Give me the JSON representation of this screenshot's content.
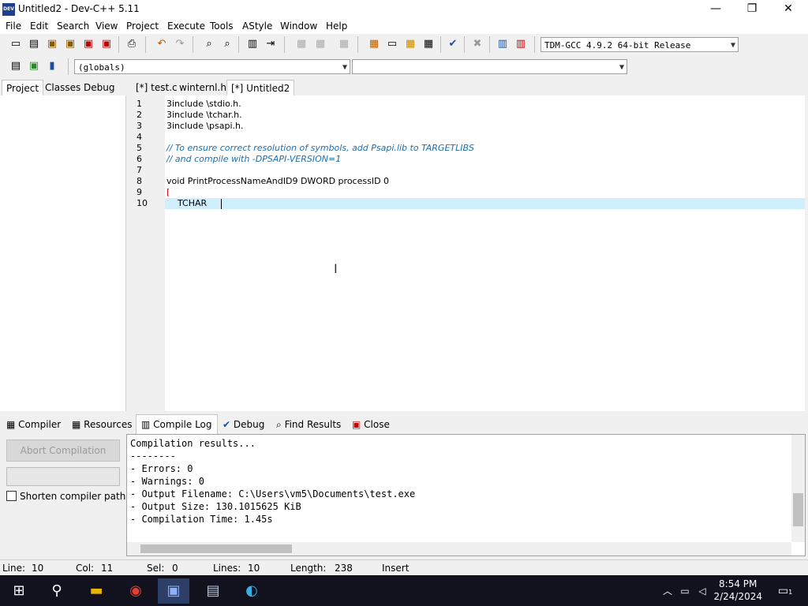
{
  "window": {
    "title": "Untitled2 - Dev-C++ 5.11",
    "app_icon_text": "DEV",
    "minimize": "—",
    "restore": "❐",
    "close": "✕"
  },
  "menu": [
    "File",
    "Edit",
    "Search",
    "View",
    "Project",
    "Execute",
    "Tools",
    "AStyle",
    "Window",
    "Help"
  ],
  "toolbar": {
    "compiler_select": "TDM-GCC 4.9.2 64-bit Release",
    "scope_select": "(globals)",
    "function_select": ""
  },
  "left_tabs": [
    "Project",
    "Classes",
    "Debug"
  ],
  "editor_tabs": [
    "[*] test.c",
    "winternl.h",
    "[*] Untitled2"
  ],
  "editor": {
    "lines": [
      {
        "n": "1",
        "text": "3include \\stdio.h."
      },
      {
        "n": "2",
        "text": "3include \\tchar.h."
      },
      {
        "n": "3",
        "text": "3include \\psapi.h."
      },
      {
        "n": "4",
        "text": ""
      },
      {
        "n": "5",
        "text": "// To ensure correct resolution of symbols, add Psapi.lib to TARGETLIBS"
      },
      {
        "n": "6",
        "text": "// and compile with -DPSAPI-VERSION=1"
      },
      {
        "n": "7",
        "text": ""
      },
      {
        "n": "8",
        "text": "void PrintProcessNameAndID9 DWORD processID 0"
      },
      {
        "n": "9",
        "text": "["
      },
      {
        "n": "10",
        "text": "    TCHAR "
      }
    ]
  },
  "bottom_tabs": [
    "Compiler",
    "Resources",
    "Compile Log",
    "Debug",
    "Find Results",
    "Close"
  ],
  "compile": {
    "abort_label": "Abort Compilation",
    "shorten_label": "Shorten compiler paths",
    "log": [
      "Compilation results...",
      "--------",
      "- Errors: 0",
      "- Warnings: 0",
      "- Output Filename: C:\\Users\\vm5\\Documents\\test.exe",
      "- Output Size: 130.1015625 KiB",
      "- Compilation Time: 1.45s"
    ]
  },
  "status": {
    "line": "Line:",
    "line_val": "10",
    "col": "Col:",
    "col_val": "11",
    "sel": "Sel:",
    "sel_val": "0",
    "lines": "Lines:",
    "lines_val": "10",
    "length": "Length:",
    "length_val": "238",
    "mode": "Insert"
  },
  "taskbar": {
    "time": "8:54 PM",
    "date": "2/24/2024",
    "notif": "1"
  }
}
